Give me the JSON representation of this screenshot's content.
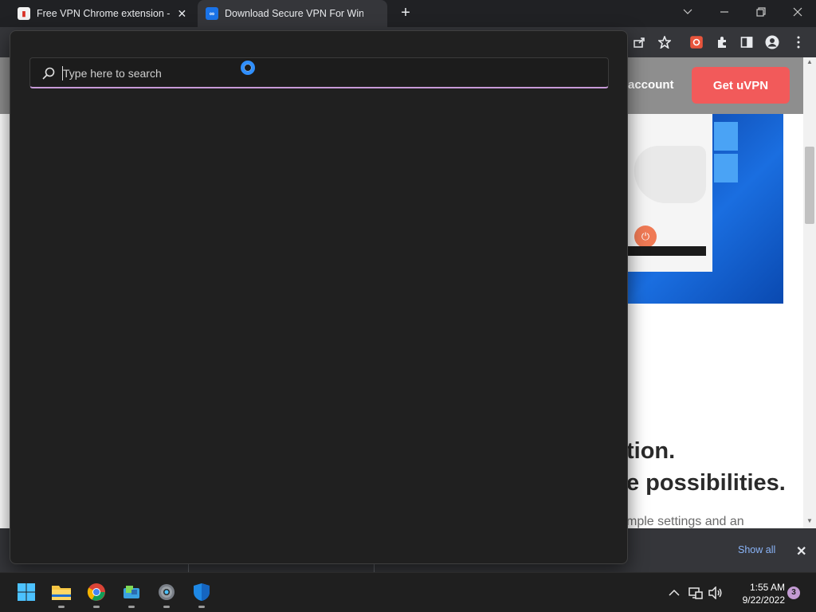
{
  "browser": {
    "tabs": [
      {
        "title": "Free VPN Chrome extension - Be",
        "active": false
      },
      {
        "title": "Download Secure VPN For Windo",
        "active": true
      }
    ],
    "new_tab": "+"
  },
  "website": {
    "account_link": "account",
    "cta_button": "Get uVPN",
    "hero_line1": "tion.",
    "hero_line2": "e possibilities.",
    "hero_subtitle": "mple settings and an",
    "colors": {
      "cta": "#f25a5a",
      "header": "#8e8e8e"
    }
  },
  "search": {
    "placeholder": "Type here to search"
  },
  "download_bar": {
    "show_all": "Show all"
  },
  "taskbar": {
    "pinned": [
      "start-icon",
      "file-explorer-icon",
      "chrome-icon",
      "app-icon",
      "settings-icon",
      "windows-security-icon"
    ],
    "time": "1:55 AM",
    "date": "9/22/2022",
    "notifications": "3"
  }
}
